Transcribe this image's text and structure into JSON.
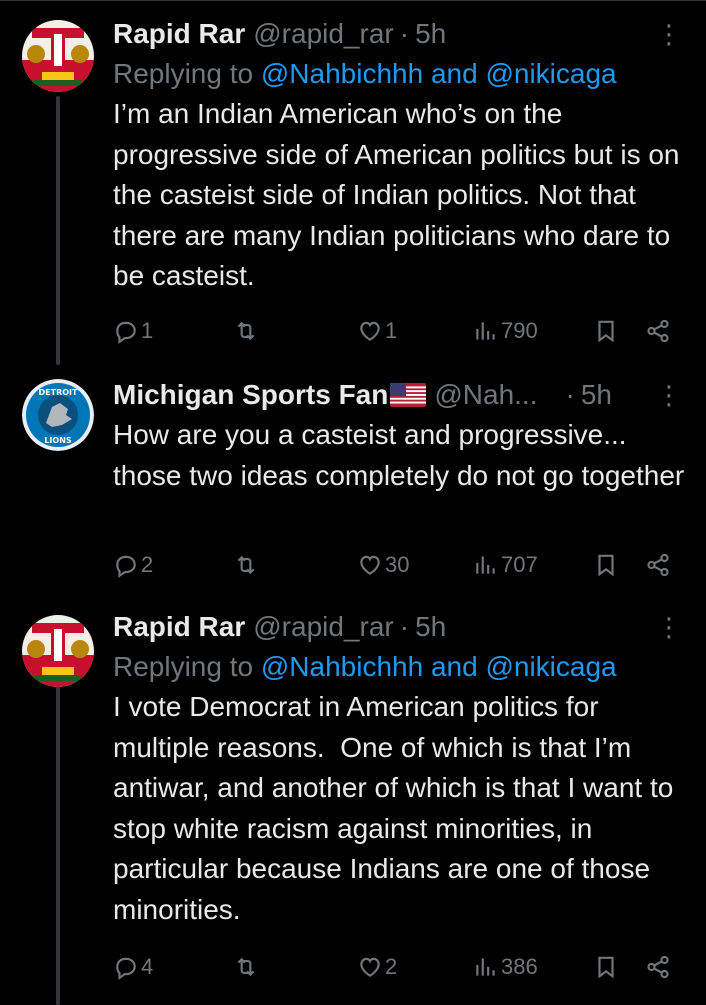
{
  "tweets": [
    {
      "name": "Rapid Rar",
      "handle": "@rapid_rar",
      "separator": "·",
      "time": "5h",
      "more": "⋮",
      "replying_prefix": "Replying to",
      "replying_mentions": "@Nahbichhh and @nikicaga",
      "text": "I’m an Indian American who’s on the progressive side of American politics but is on the casteist side of Indian politics. Not that there are many Indian politicians who dare to be casteist.",
      "replies": "1",
      "reposts": "",
      "likes": "1",
      "views": "790",
      "avatar_icon": "flag-crest-avatar"
    },
    {
      "name": "Michigan Sports Fan",
      "handle": "@Nah...",
      "separator": "·",
      "time": "5h",
      "more": "⋮",
      "text": "How are you a casteist and progressive... those two ideas completely do not go together",
      "replies": "2",
      "reposts": "",
      "likes": "30",
      "views": "707",
      "avatar_icon": "detroit-lions-avatar",
      "avatar_text_top": "DETROIT",
      "avatar_text_bottom": "LIONS",
      "name_emoji": "us-flag-icon"
    },
    {
      "name": "Rapid Rar",
      "handle": "@rapid_rar",
      "separator": "·",
      "time": "5h",
      "more": "⋮",
      "replying_prefix": "Replying to",
      "replying_mentions": "@Nahbichhh and @nikicaga",
      "text": "I vote Democrat in American politics for multiple reasons.  One of which is that I’m antiwar, and another of which is that I want to stop white racism against minorities, in particular because Indians are one of those minorities.",
      "replies": "4",
      "reposts": "",
      "likes": "2",
      "views": "386",
      "avatar_icon": "flag-crest-avatar"
    }
  ],
  "colors": {
    "background": "#000000",
    "text": "#e7e9ea",
    "muted": "#71767b",
    "link": "#1d9bf0",
    "thread_line": "#333639"
  }
}
